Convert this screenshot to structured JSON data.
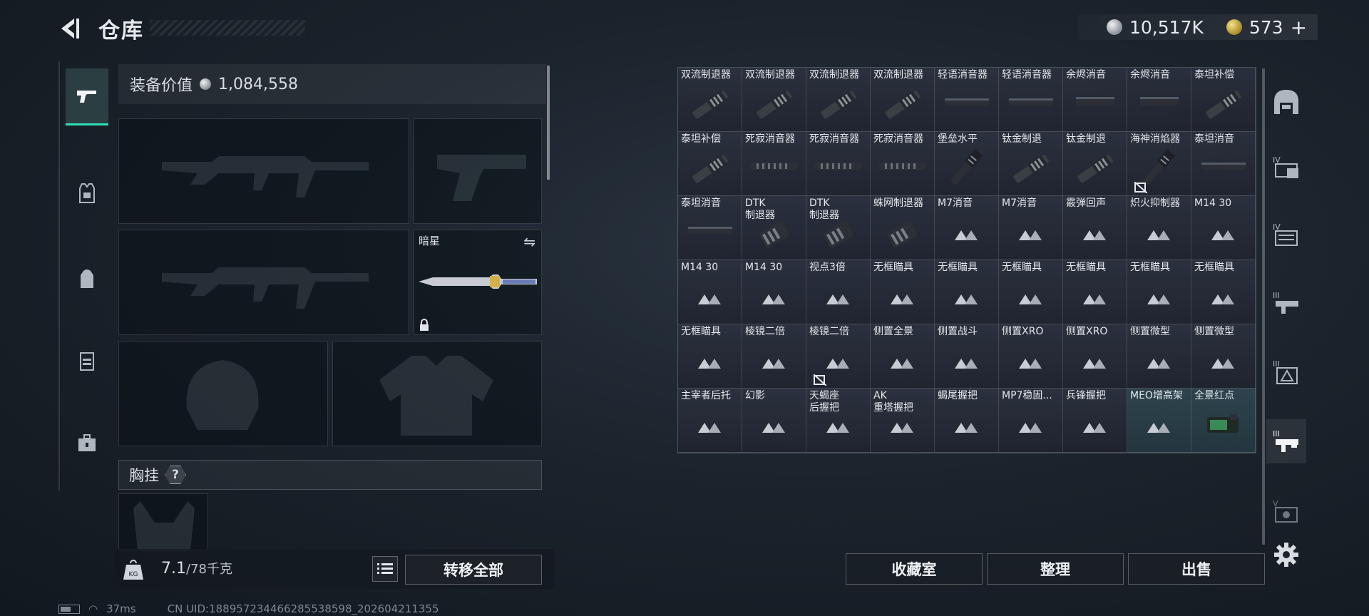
{
  "header": {
    "title": "仓库"
  },
  "currency": {
    "coins": "10,517K",
    "gold": "573",
    "gold_plus": "+"
  },
  "loadout": {
    "equipment_value_label": "装备价值",
    "equipment_value": "1,084,558",
    "melee_label": "暗星",
    "chest_rig_label": "胸挂",
    "chest_help": "?"
  },
  "footer": {
    "weight_current": "7.1",
    "weight_max": "/78千克",
    "transfer_all": "转移全部",
    "collection_room": "收藏室",
    "organize": "整理",
    "sell": "出售"
  },
  "status": {
    "ping": "37ms",
    "uid": "CN UID:1889572344662855385​98_202604211355"
  },
  "inventory": [
    {
      "name": "双流制退器",
      "icon": "muzzle-brake"
    },
    {
      "name": "双流制退器",
      "icon": "muzzle-brake"
    },
    {
      "name": "双流制退器",
      "icon": "muzzle-brake"
    },
    {
      "name": "双流制退器",
      "icon": "muzzle-brake"
    },
    {
      "name": "轻语消音器",
      "icon": "suppressor"
    },
    {
      "name": "轻语消音器",
      "icon": "suppressor"
    },
    {
      "name": "余烬消音",
      "icon": "suppressor-short"
    },
    {
      "name": "余烬消音",
      "icon": "suppressor-short"
    },
    {
      "name": "泰坦补偿",
      "icon": "muzzle-brake"
    },
    {
      "name": "泰坦补偿",
      "icon": "muzzle-brake"
    },
    {
      "name": "死寂消音器",
      "icon": "suppressor-ribbed"
    },
    {
      "name": "死寂消音器",
      "icon": "suppressor-ribbed"
    },
    {
      "name": "死寂消音器",
      "icon": "suppressor-ribbed"
    },
    {
      "name": "堡垒水平",
      "icon": "flash-hider"
    },
    {
      "name": "钛金制退",
      "icon": "muzzle-brake"
    },
    {
      "name": "钛金制退",
      "icon": "muzzle-brake"
    },
    {
      "name": "海神消焰器",
      "icon": "flash-hider",
      "flag": true
    },
    {
      "name": "泰坦消音",
      "icon": "suppressor"
    },
    {
      "name": "泰坦消音",
      "icon": "suppressor"
    },
    {
      "name": "DTK\n制退器",
      "icon": "compensator"
    },
    {
      "name": "DTK\n制退器",
      "icon": "compensator"
    },
    {
      "name": "蛛网制退器",
      "icon": "compensator"
    },
    {
      "name": "M7消音",
      "icon": "placeholder"
    },
    {
      "name": "M7消音",
      "icon": "placeholder"
    },
    {
      "name": "霰弹回声",
      "icon": "placeholder"
    },
    {
      "name": "炽火抑制器",
      "icon": "placeholder"
    },
    {
      "name": "M14 30",
      "icon": "placeholder"
    },
    {
      "name": "M14 30",
      "icon": "placeholder"
    },
    {
      "name": "M14 30",
      "icon": "placeholder"
    },
    {
      "name": "视点3倍",
      "icon": "placeholder"
    },
    {
      "name": "无框瞄具",
      "icon": "placeholder"
    },
    {
      "name": "无框瞄具",
      "icon": "placeholder"
    },
    {
      "name": "无框瞄具",
      "icon": "placeholder"
    },
    {
      "name": "无框瞄具",
      "icon": "placeholder"
    },
    {
      "name": "无框瞄具",
      "icon": "placeholder"
    },
    {
      "name": "无框瞄具",
      "icon": "placeholder"
    },
    {
      "name": "无框瞄具",
      "icon": "placeholder"
    },
    {
      "name": "棱镜二倍",
      "icon": "placeholder"
    },
    {
      "name": "棱镜二倍",
      "icon": "placeholder",
      "flag": true
    },
    {
      "name": "侧置全景",
      "icon": "placeholder"
    },
    {
      "name": "侧置战斗",
      "icon": "placeholder"
    },
    {
      "name": "侧置XRO",
      "icon": "placeholder"
    },
    {
      "name": "侧置XRO",
      "icon": "placeholder"
    },
    {
      "name": "侧置微型",
      "icon": "placeholder"
    },
    {
      "name": "侧置微型",
      "icon": "placeholder"
    },
    {
      "name": "主宰者后托",
      "icon": "placeholder"
    },
    {
      "name": "幻影",
      "icon": "placeholder"
    },
    {
      "name": "天蝎座\n后握把",
      "icon": "placeholder"
    },
    {
      "name": "AK\n重塔握把",
      "icon": "placeholder"
    },
    {
      "name": "蝎尾握把",
      "icon": "placeholder"
    },
    {
      "name": "MP7稳固...",
      "icon": "placeholder"
    },
    {
      "name": "兵锋握把",
      "icon": "placeholder"
    },
    {
      "name": "MEO增高架",
      "icon": "placeholder",
      "teal": true
    },
    {
      "name": "全景红点",
      "icon": "red-dot-sight",
      "teal": true
    }
  ],
  "colors": {
    "active_tab_accent": "#2ee0b8",
    "teal_cell": "#30485a"
  }
}
